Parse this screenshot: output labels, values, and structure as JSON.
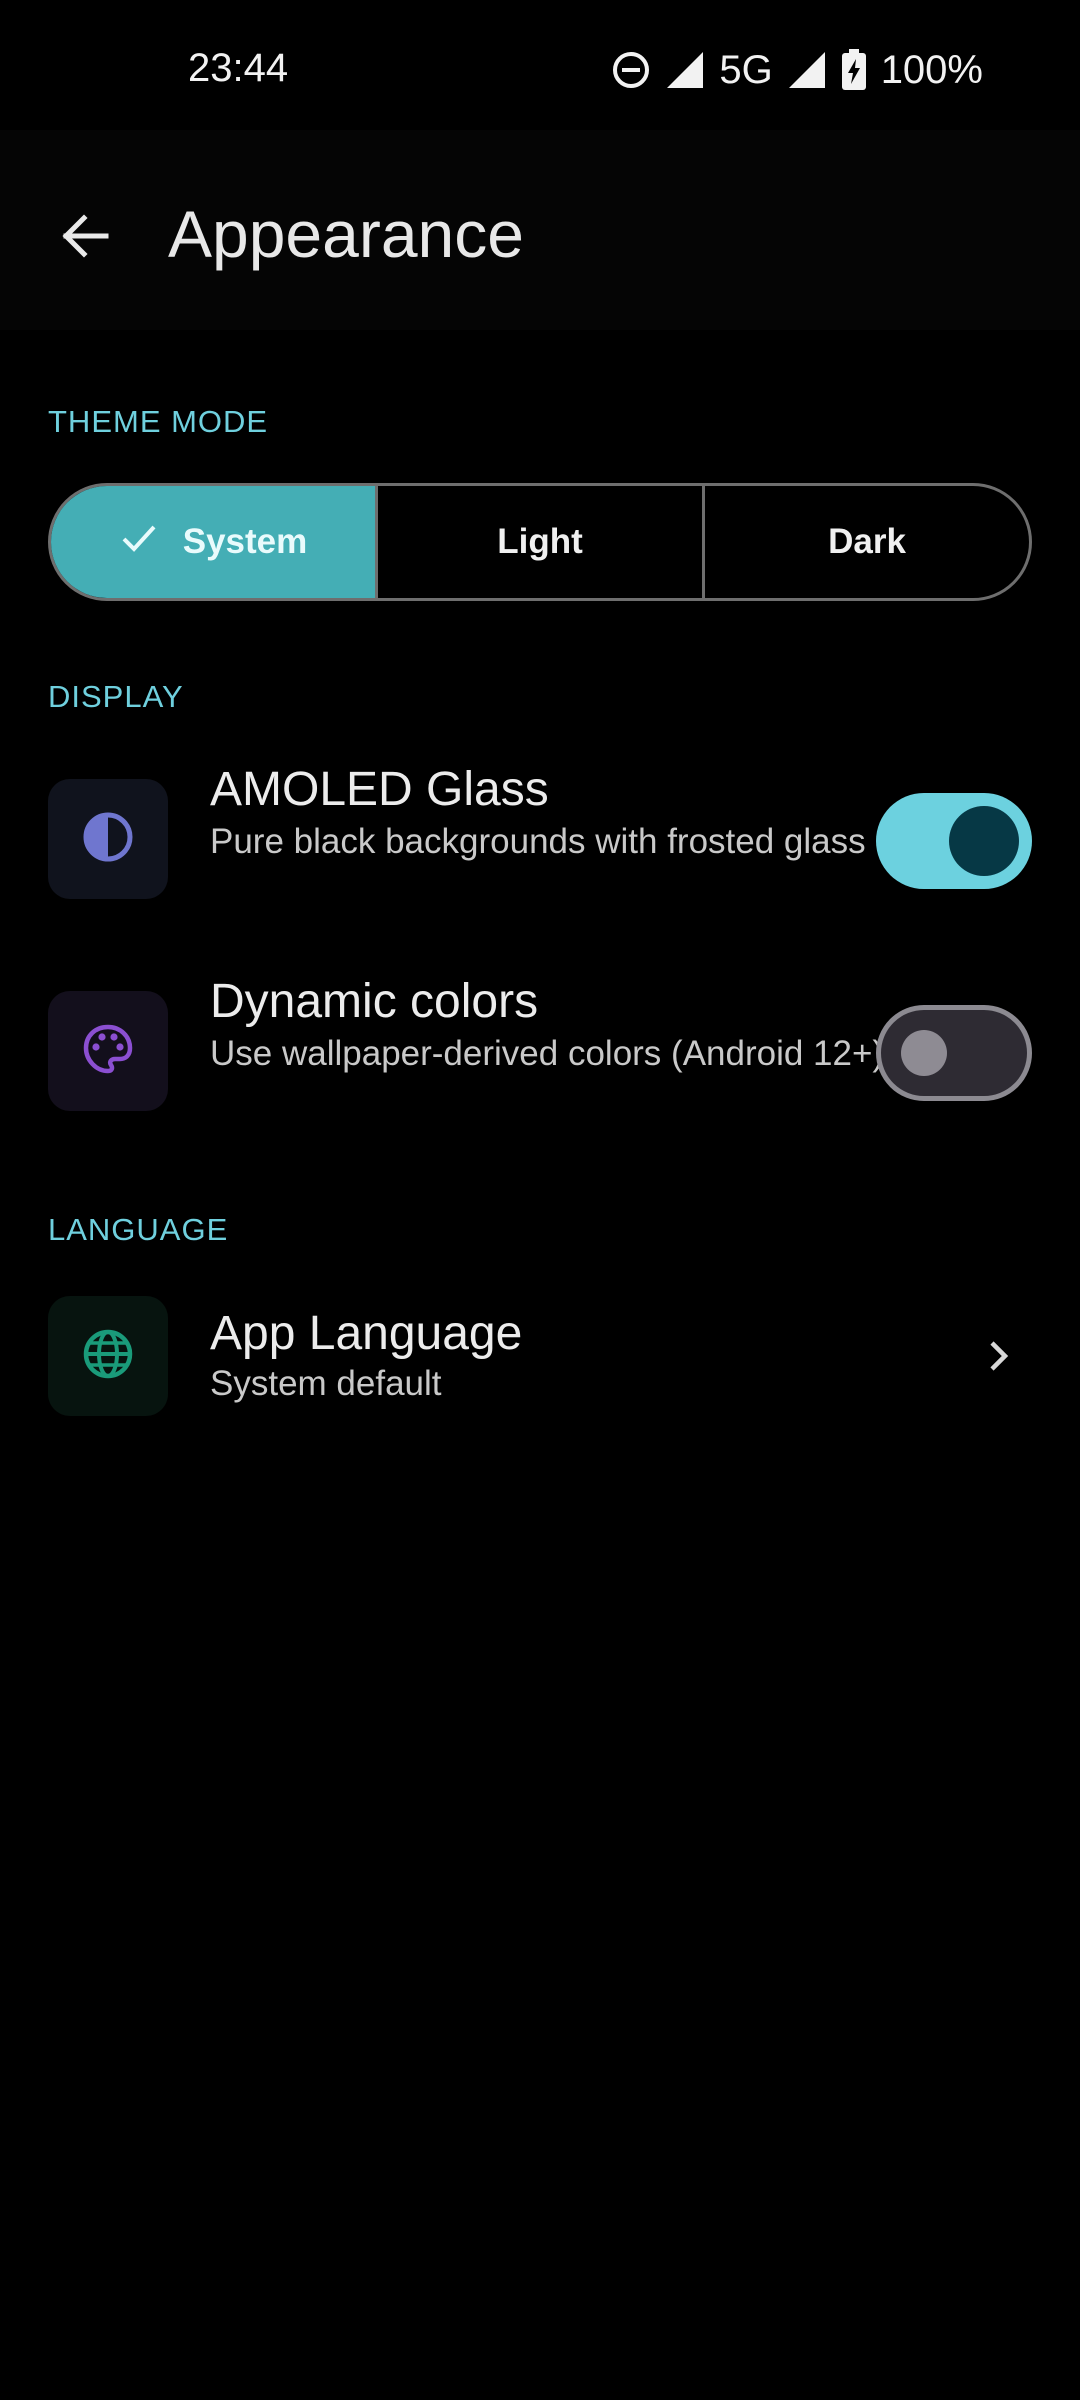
{
  "status_bar": {
    "time": "23:44",
    "network": "5G",
    "battery": "100%",
    "icons": [
      "do-not-disturb-icon",
      "signal-icon",
      "signal-icon",
      "battery-charging-icon"
    ]
  },
  "app_bar": {
    "title": "Appearance",
    "back_icon": "arrow-back-icon"
  },
  "theme_mode": {
    "header": "THEME MODE",
    "options": [
      {
        "label": "System",
        "selected": true
      },
      {
        "label": "Light",
        "selected": false
      },
      {
        "label": "Dark",
        "selected": false
      }
    ]
  },
  "display": {
    "header": "DISPLAY",
    "items": [
      {
        "title": "AMOLED Glass",
        "subtitle": "Pure black backgrounds with frosted glass",
        "icon": "contrast-icon",
        "toggle": "on"
      },
      {
        "title": "Dynamic colors",
        "subtitle": "Use wallpaper-derived colors (Android 12+)",
        "icon": "palette-icon",
        "toggle": "off"
      }
    ]
  },
  "language": {
    "header": "LANGUAGE",
    "item": {
      "title": "App Language",
      "subtitle": "System default",
      "icon": "globe-icon"
    }
  },
  "colors": {
    "accent": "#6fd0de",
    "segment_selected": "#44aeb5",
    "toggle_on": "#6cd1df",
    "background": "#000000"
  }
}
